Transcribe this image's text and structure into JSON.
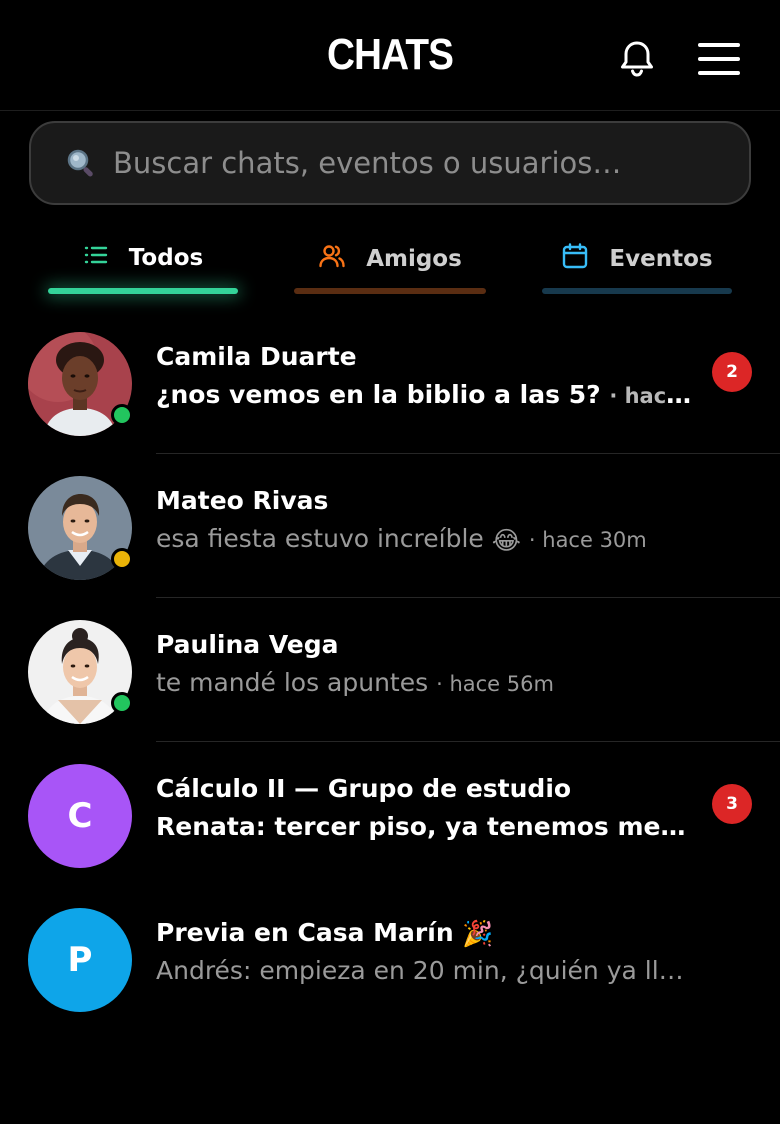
{
  "header": {
    "title": "CHATS",
    "bell_icon": "bell-icon",
    "menu_icon": "hamburger-menu-icon"
  },
  "search": {
    "placeholder": "Buscar chats, eventos o usuarios…",
    "icon": "search-icon"
  },
  "tabs": [
    {
      "label": "Todos",
      "icon": "list-icon",
      "active": true,
      "color": "#34d399"
    },
    {
      "label": "Amigos",
      "icon": "users-icon",
      "active": false,
      "color": "#f97316"
    },
    {
      "label": "Eventos",
      "icon": "calendar-icon",
      "active": false,
      "color": "#38bdf8"
    }
  ],
  "chats": [
    {
      "name": "Camila Duarte",
      "preview": "¿nos vemos en la biblio a las 5?",
      "time": "· hace …",
      "unread": 2,
      "status": "online",
      "status_color": "#22c55e"
    },
    {
      "name": "Mateo Rivas",
      "preview": "esa fiesta estuvo increíble",
      "emoji": "😂",
      "time": "· hace 30m",
      "status": "away",
      "status_color": "#eab308"
    },
    {
      "name": "Paulina Vega",
      "preview": "te mandé los apuntes",
      "time": "· hace 56m",
      "status": "online",
      "status_color": "#22c55e"
    },
    {
      "name": "Cálculo II — Grupo de estudio",
      "preview": "Renata: tercer piso, ya tenemos mes…",
      "unread": 3,
      "avatar_letter": "C",
      "avatar_color": "#a855f7"
    },
    {
      "name": "Previa en Casa Marín",
      "name_emoji": "🎉",
      "preview": "Andrés: empieza en 20 min, ¿quién ya ll…",
      "avatar_letter": "P",
      "avatar_color": "#0ea5e9"
    }
  ]
}
